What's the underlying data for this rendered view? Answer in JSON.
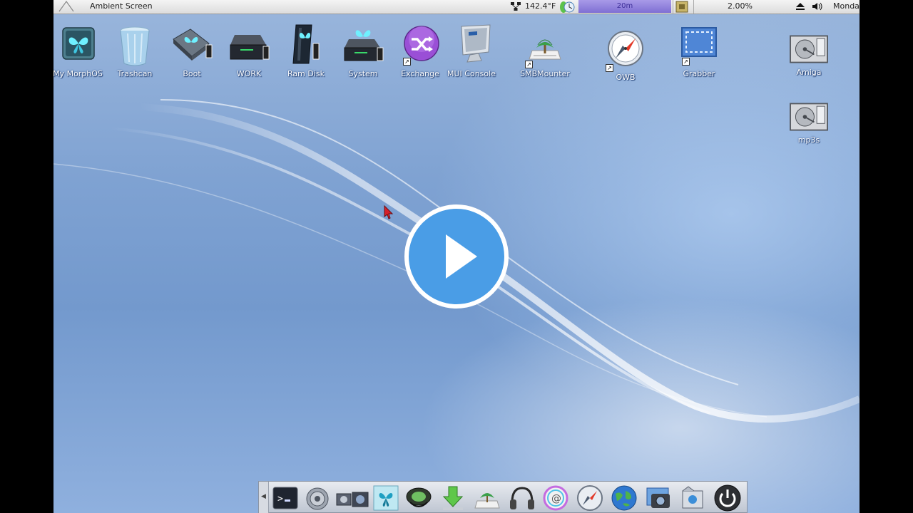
{
  "menubar": {
    "title": "Ambient Screen",
    "temperature": "142.4°F",
    "meter_label": "20m",
    "cpu_usage": "2.00%",
    "day": "Monday"
  },
  "desktop_icons": [
    {
      "name": "my-morphos-icon",
      "label": "My MorphOS"
    },
    {
      "name": "trashcan-icon",
      "label": "Trashcan"
    },
    {
      "name": "boot-drive-icon",
      "label": "Boot"
    },
    {
      "name": "work-drive-icon",
      "label": "WORK"
    },
    {
      "name": "ram-disk-icon",
      "label": "Ram Disk"
    },
    {
      "name": "system-drive-icon",
      "label": "System"
    },
    {
      "name": "exchange-icon",
      "label": "Exchange"
    },
    {
      "name": "mui-console-icon",
      "label": "MUI Console"
    },
    {
      "name": "smbmounter-icon",
      "label": "SMBMounter"
    },
    {
      "name": "owb-browser-icon",
      "label": "OWB"
    },
    {
      "name": "grabber-icon",
      "label": "Grabber"
    },
    {
      "name": "amiga-drive-icon",
      "label": "Amiga"
    },
    {
      "name": "mp3s-drive-icon",
      "label": "mp3s"
    }
  ],
  "dock": {
    "items": [
      "shell-icon",
      "settings-gear-icon",
      "multimedia-icon",
      "morphos-icon",
      "sound-icon",
      "download-icon",
      "network-icon",
      "headphones-icon",
      "mail-icon",
      "browser-compass-icon",
      "globe-icon",
      "photo-icon",
      "screenshot-icon",
      "power-icon"
    ]
  },
  "colors": {
    "desktop_blue": "#7fa2d2",
    "play_button": "#4a9de6",
    "meter": "#8f80dd"
  }
}
